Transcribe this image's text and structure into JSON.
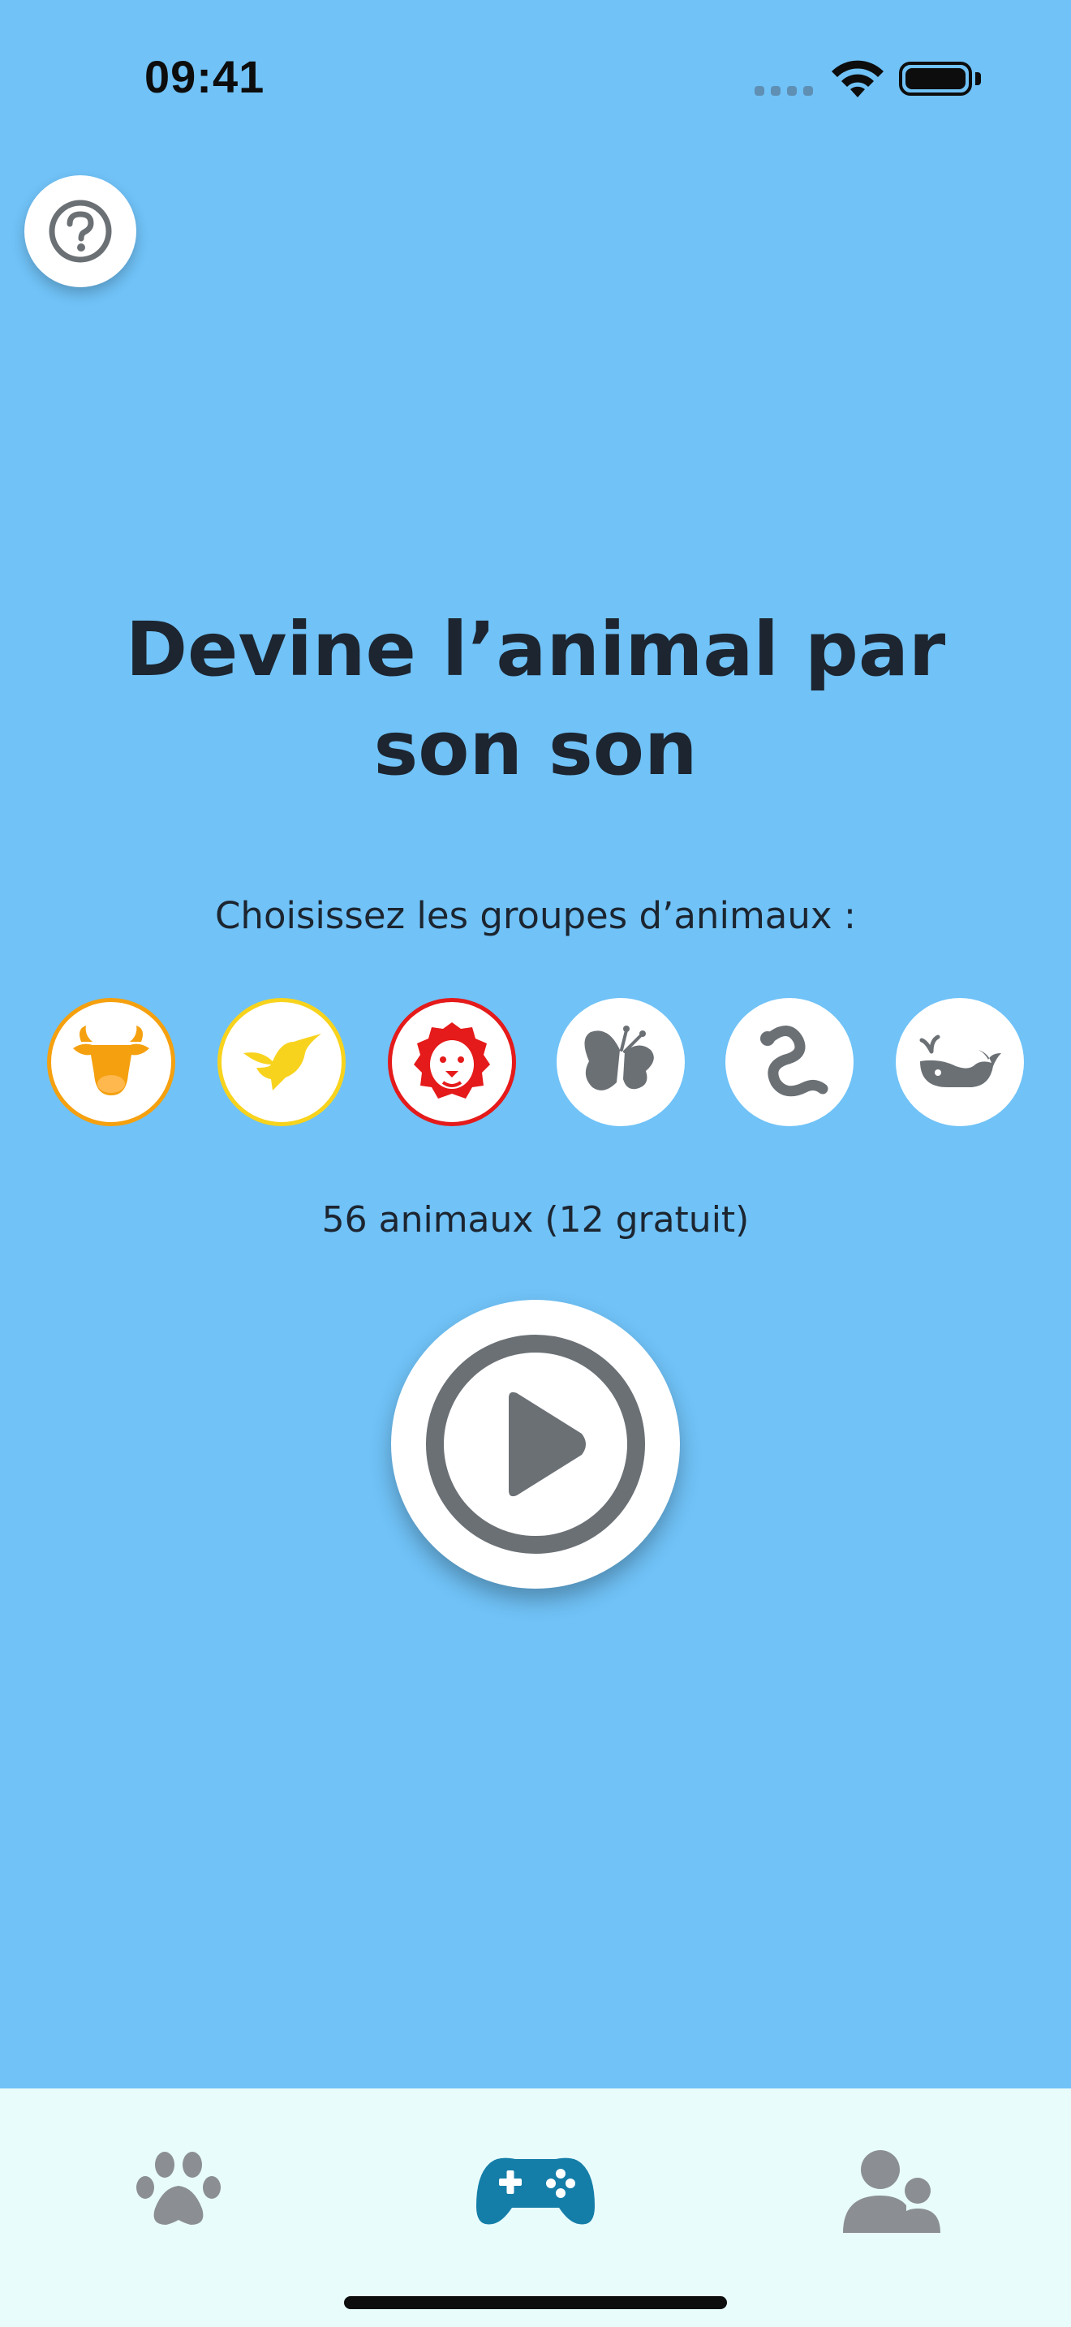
{
  "status_bar": {
    "time": "09:41"
  },
  "main": {
    "title": "Devine l’animal par son son",
    "groups_label": "Choisissez les groupes d’animaux :",
    "groups": [
      {
        "name": "farm",
        "icon": "cow-icon",
        "selected": true,
        "color": "#f5a00f"
      },
      {
        "name": "birds",
        "icon": "hummingbird-icon",
        "selected": true,
        "color": "#f8d31d"
      },
      {
        "name": "wild",
        "icon": "lion-icon",
        "selected": true,
        "color": "#e51a1a"
      },
      {
        "name": "insects",
        "icon": "butterfly-icon",
        "selected": false,
        "color": "#6b7075"
      },
      {
        "name": "reptiles",
        "icon": "snake-icon",
        "selected": false,
        "color": "#6b7075"
      },
      {
        "name": "sea",
        "icon": "whale-icon",
        "selected": false,
        "color": "#6b7075"
      }
    ],
    "count_text": "56 animaux (12 gratuit)",
    "play_icon": "play-circle-icon"
  },
  "tab_bar": {
    "tabs": [
      {
        "name": "animals",
        "icon": "paw-icon",
        "active": false,
        "color": "#8b8f94"
      },
      {
        "name": "game",
        "icon": "gamepad-icon",
        "active": true,
        "color": "#157ea8"
      },
      {
        "name": "profile",
        "icon": "users-icon",
        "active": false,
        "color": "#8b8f94"
      }
    ]
  },
  "colors": {
    "background": "#70c2f7",
    "tab_bar_background": "#e8fcfc",
    "icon_gray": "#6b7075"
  }
}
